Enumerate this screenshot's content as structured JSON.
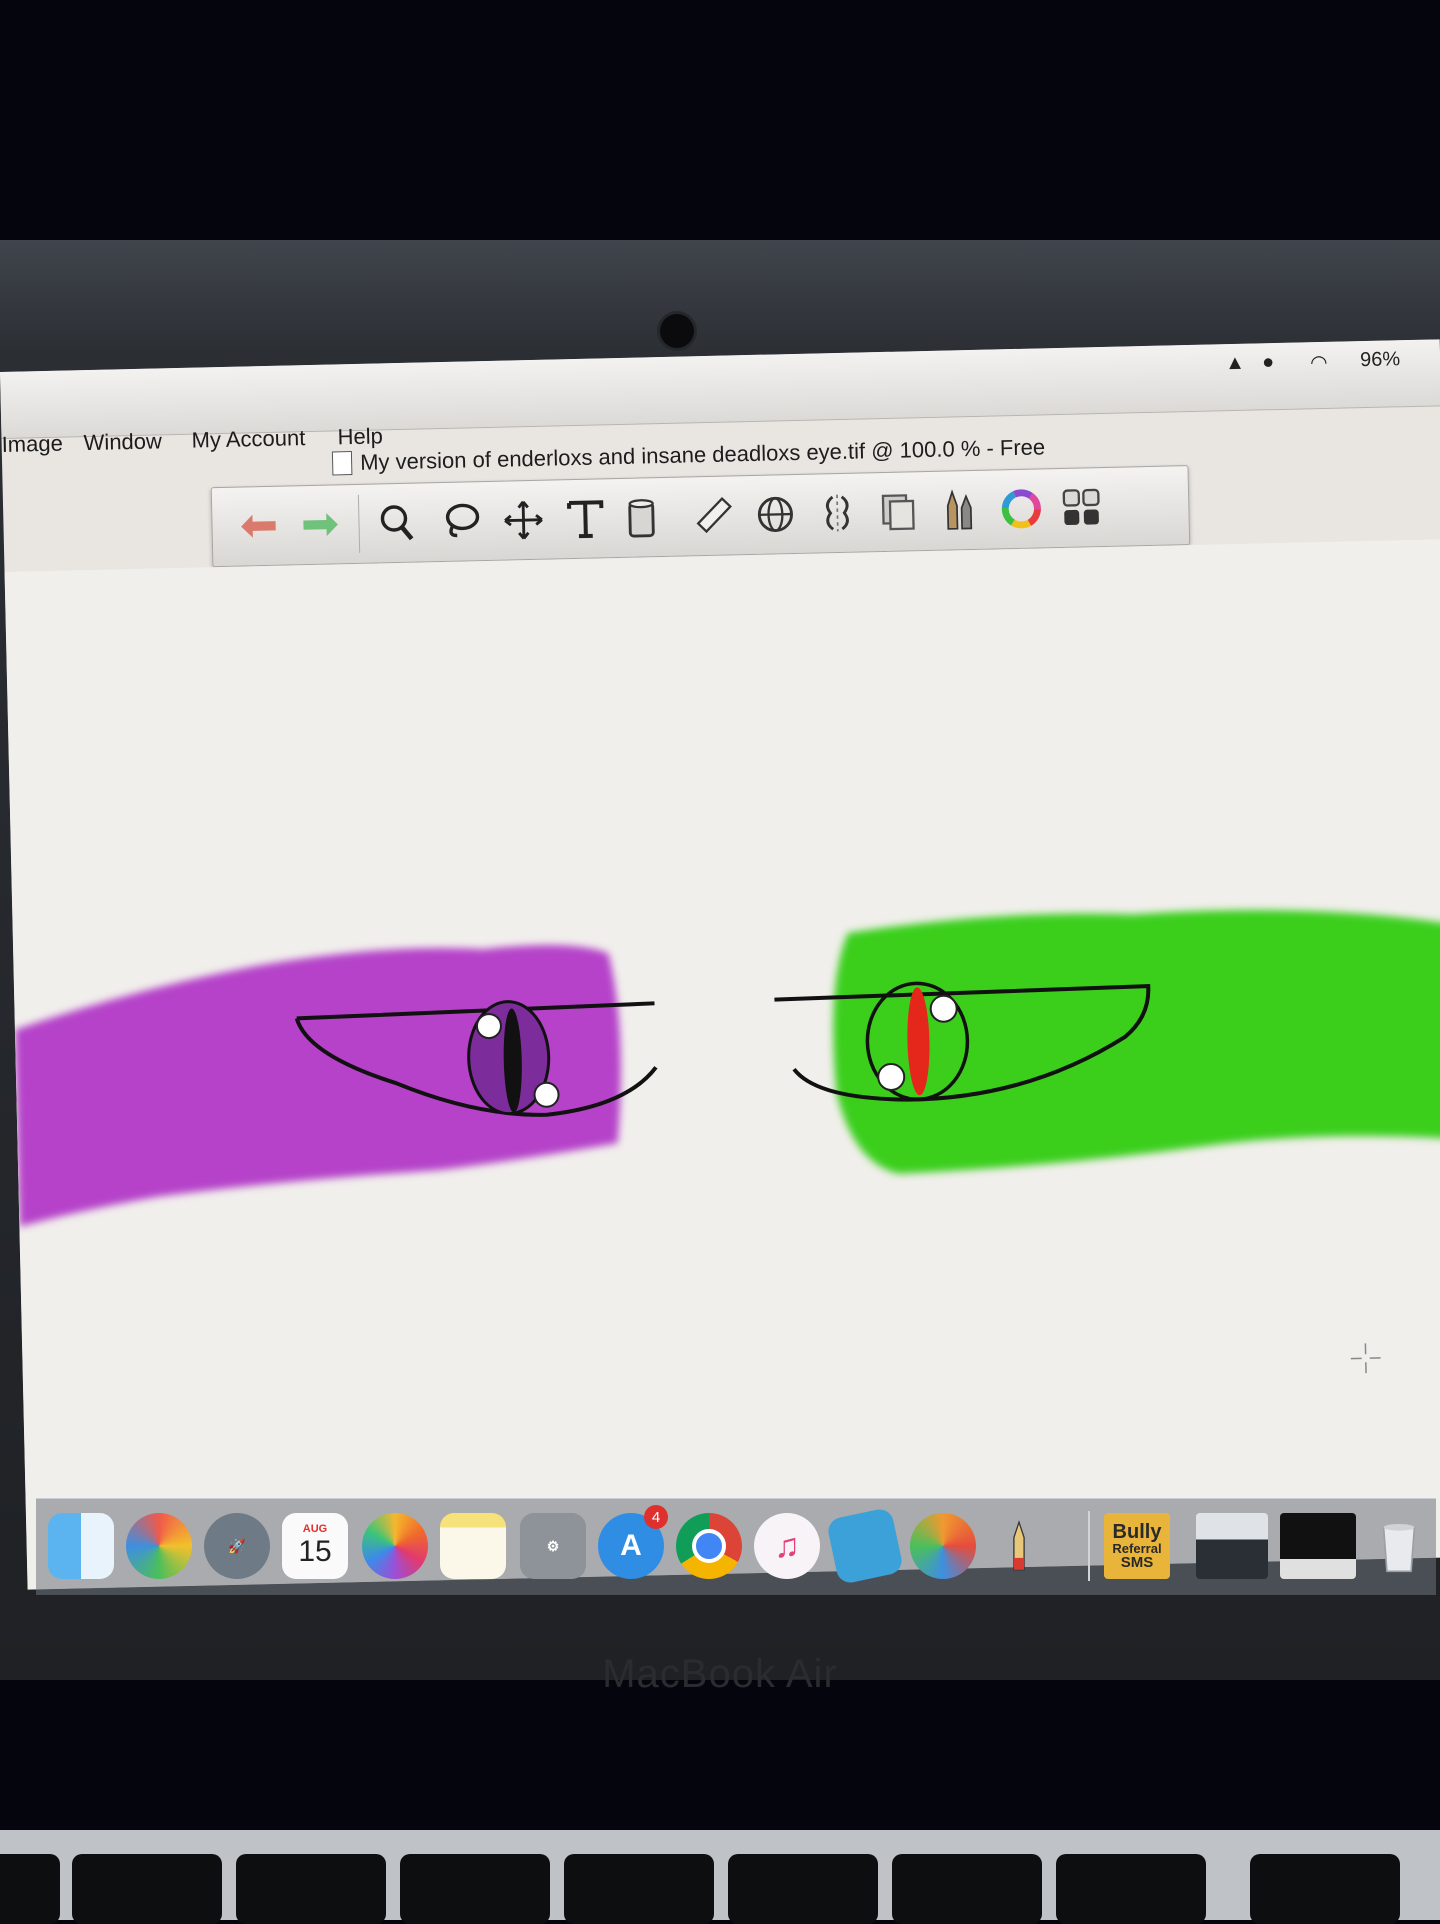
{
  "menubar": {
    "items": [
      "Image",
      "Window",
      "My Account",
      "Help"
    ],
    "battery": "96%"
  },
  "document": {
    "title": "My version of enderloxs and insane deadloxs eye.tif @ 100.0 % - Free"
  },
  "toolbar": {
    "tools": [
      "undo-icon",
      "redo-icon",
      "zoom-icon",
      "lasso-icon",
      "move-icon",
      "text-icon",
      "bucket-icon",
      "ruler-icon",
      "globe-icon",
      "symmetry-icon",
      "layers-icon",
      "brushes-icon",
      "color-wheel-icon",
      "grid-icon"
    ]
  },
  "canvas": {
    "left_eye_color": "#b542c9",
    "right_eye_color": "#3bcf1f",
    "left_pupil_color": "#111111",
    "right_pupil_color": "#e5271b"
  },
  "dock": {
    "calendar_month": "AUG",
    "calendar_day": "15",
    "appstore_badge": "4",
    "bully_line1": "Bully",
    "bully_line2": "Referral",
    "bully_line3": "SMS"
  },
  "device": {
    "label": "MacBook Air"
  }
}
